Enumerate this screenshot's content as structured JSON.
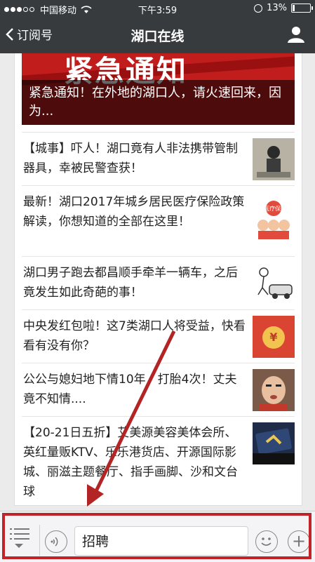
{
  "status_bar": {
    "carrier": "中国移动",
    "time": "下午3:59",
    "battery": "13%",
    "battery_level": 0.13
  },
  "nav": {
    "back_label": "订阅号",
    "title": "湖口在线"
  },
  "hero": {
    "banner_text": "紧急通知",
    "caption": "紧急通知！在外地的湖口人，请火速回来，因为..."
  },
  "articles": [
    {
      "title": "【城事】吓人！湖口竟有人非法携带管制器具，幸被民警查获！",
      "thumb_icon": "person-photo-icon"
    },
    {
      "title": "最新！湖口2017年城乡居民医疗保险政策解读，你想知道的全部在这里！",
      "thumb_icon": "medical-insurance-icon",
      "thumb_label": "医疗保险"
    },
    {
      "title": "湖口男子跑去都昌顺手牵羊一辆车，之后竟发生如此奇葩的事！",
      "thumb_icon": "car-cartoon-icon"
    },
    {
      "title": "中央发红包啦！这7类湖口人将受益，快看看有没有你？",
      "thumb_icon": "red-envelope-icon",
      "thumb_label": "¥"
    },
    {
      "title": "公公与媳妇地下情10年，打胎4次！丈夫竟不知情....",
      "thumb_icon": "face-photo-icon"
    },
    {
      "title": "【20-21日五折】艾美源美容美体会所、英红量贩KTV、乐乐港货店、开源国际影城、丽滋主题餐厅、指手画脚、沙和文台球",
      "thumb_icon": "ticket-photo-icon"
    }
  ],
  "bottom_bar": {
    "menu_label": "招聘"
  },
  "colors": {
    "nav_bg": "#373b3e",
    "highlight": "#c0232a",
    "hero_bg": "#c11d1d"
  }
}
